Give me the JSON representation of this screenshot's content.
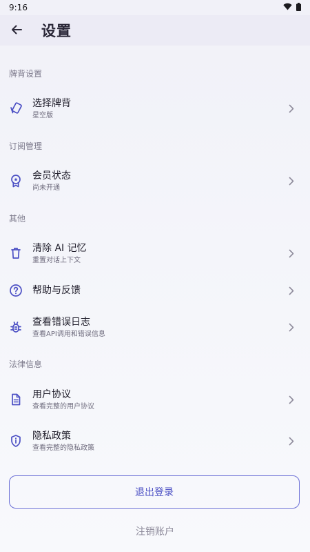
{
  "status_bar": {
    "time": "9:16"
  },
  "app_bar": {
    "title": "设置"
  },
  "sections": {
    "card_back": {
      "header": "牌背设置",
      "items": [
        {
          "title": "选择牌背",
          "subtitle": "星空版"
        }
      ]
    },
    "subscription": {
      "header": "订阅管理",
      "items": [
        {
          "title": "会员状态",
          "subtitle": "尚未开通"
        }
      ]
    },
    "other": {
      "header": "其他",
      "items": [
        {
          "title": "清除 AI 记忆",
          "subtitle": "重置对话上下文"
        },
        {
          "title": "帮助与反馈",
          "subtitle": ""
        },
        {
          "title": "查看错误日志",
          "subtitle": "查看API调用和错误信息"
        }
      ]
    },
    "legal": {
      "header": "法律信息",
      "items": [
        {
          "title": "用户协议",
          "subtitle": "查看完整的用户协议"
        },
        {
          "title": "隐私政策",
          "subtitle": "查看完整的隐私政策"
        }
      ]
    }
  },
  "actions": {
    "logout": "退出登录",
    "delete_account": "注销账户"
  },
  "colors": {
    "accent": "#4b4fc4",
    "icon": "#4b4fc4",
    "app_bar_bg": "#ecebf5"
  },
  "icons": {
    "status": [
      "wifi-icon",
      "battery-icon"
    ],
    "back": "arrow-left-icon",
    "card_back": "cards-icon",
    "subscription": "badge-icon",
    "clear_memory": "trash-icon",
    "help": "help-circle-icon",
    "error_log": "bug-icon",
    "agreement": "document-icon",
    "privacy": "shield-icon",
    "chevron": "chevron-right-icon"
  }
}
